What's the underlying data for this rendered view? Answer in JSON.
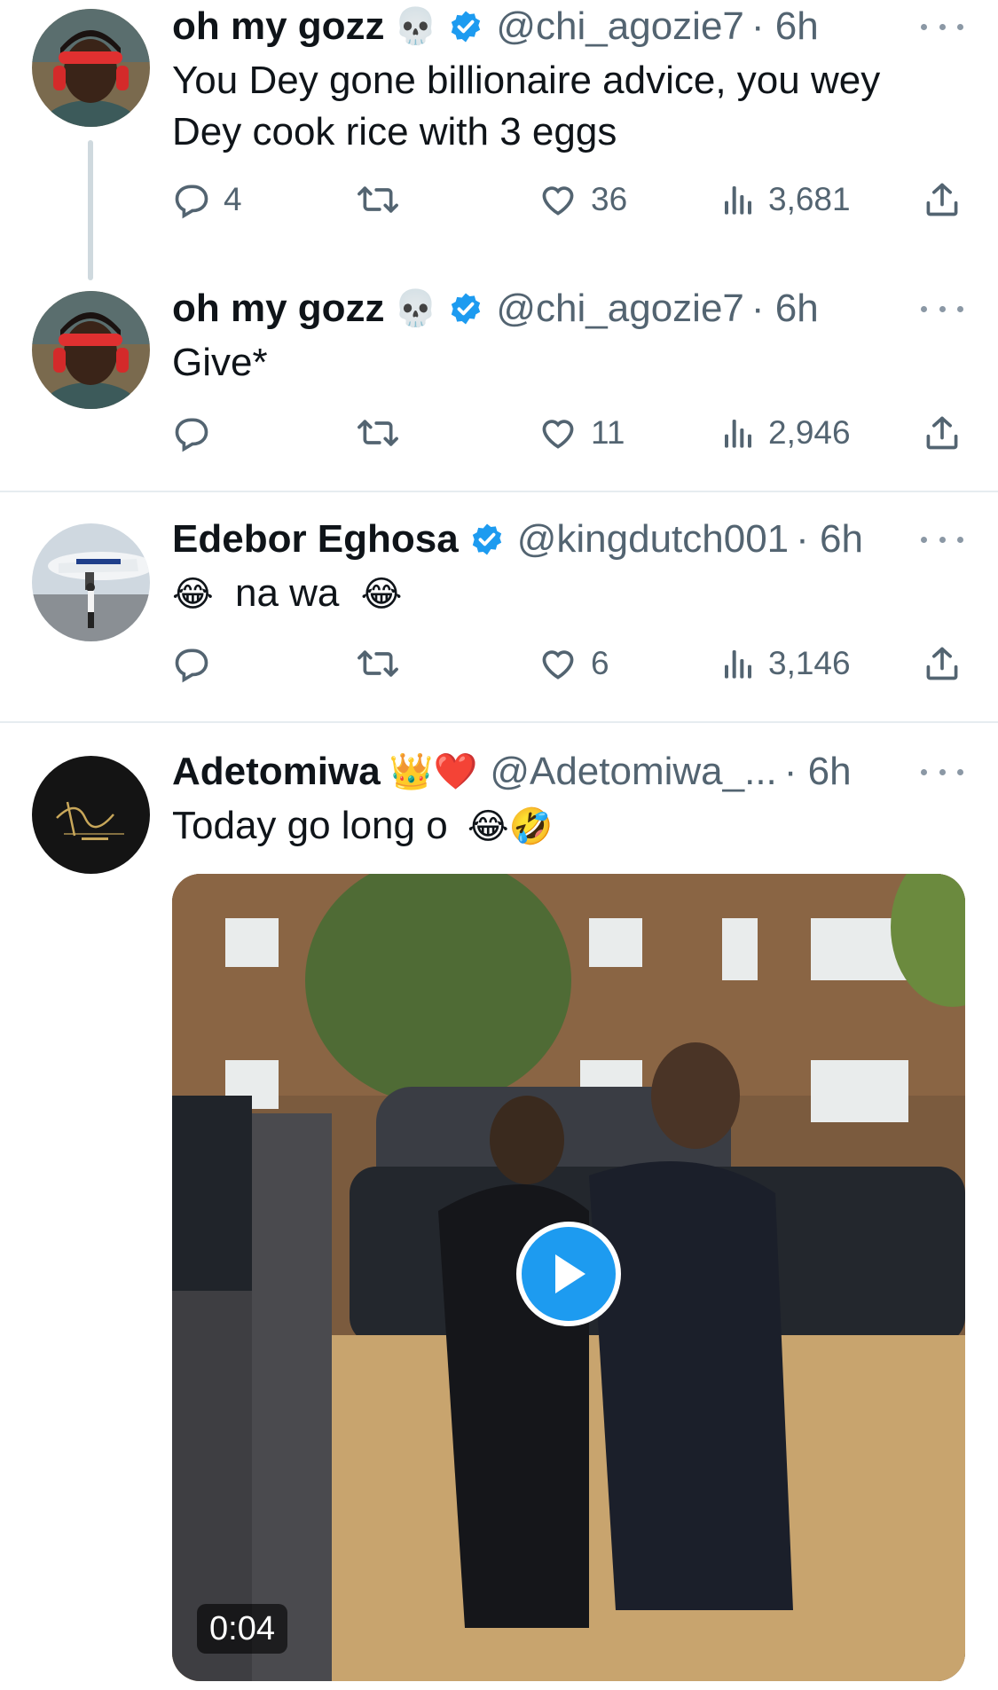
{
  "accent": "#1d9bf0",
  "tweets": [
    {
      "name": "oh my gozz",
      "name_emoji": "💀",
      "handle": "@chi_agozie7",
      "time": "· 6h",
      "text_lines": [
        "You Dey gone billionaire advice, you wey",
        "Dey cook rice with 3 eggs"
      ],
      "replies": "4",
      "retweets": "",
      "likes": "36",
      "views": "3,681",
      "avatar_icon": "person-red-headphones"
    },
    {
      "name": "oh my gozz",
      "name_emoji": "💀",
      "handle": "@chi_agozie7",
      "time": "· 6h",
      "text": "Give*",
      "replies": "",
      "retweets": "",
      "likes": "11",
      "views": "2,946",
      "avatar_icon": "person-red-headphones"
    },
    {
      "name": "Edebor Eghosa",
      "handle": "@kingdutch001",
      "time": "· 6h",
      "text": "na wa",
      "text_emoji_before": "😂",
      "text_emoji_after": "😂",
      "replies": "",
      "retweets": "",
      "likes": "6",
      "views": "3,146",
      "avatar_icon": "person-airplane"
    },
    {
      "name": "Adetomiwa",
      "name_emoji": "👑❤️",
      "handle": "@Adetomiwa_...",
      "time": "· 6h",
      "text": "Today go long o",
      "text_emoji_after": "😂🤣",
      "video_duration": "0:04",
      "avatar_icon": "signature-logo"
    }
  ]
}
